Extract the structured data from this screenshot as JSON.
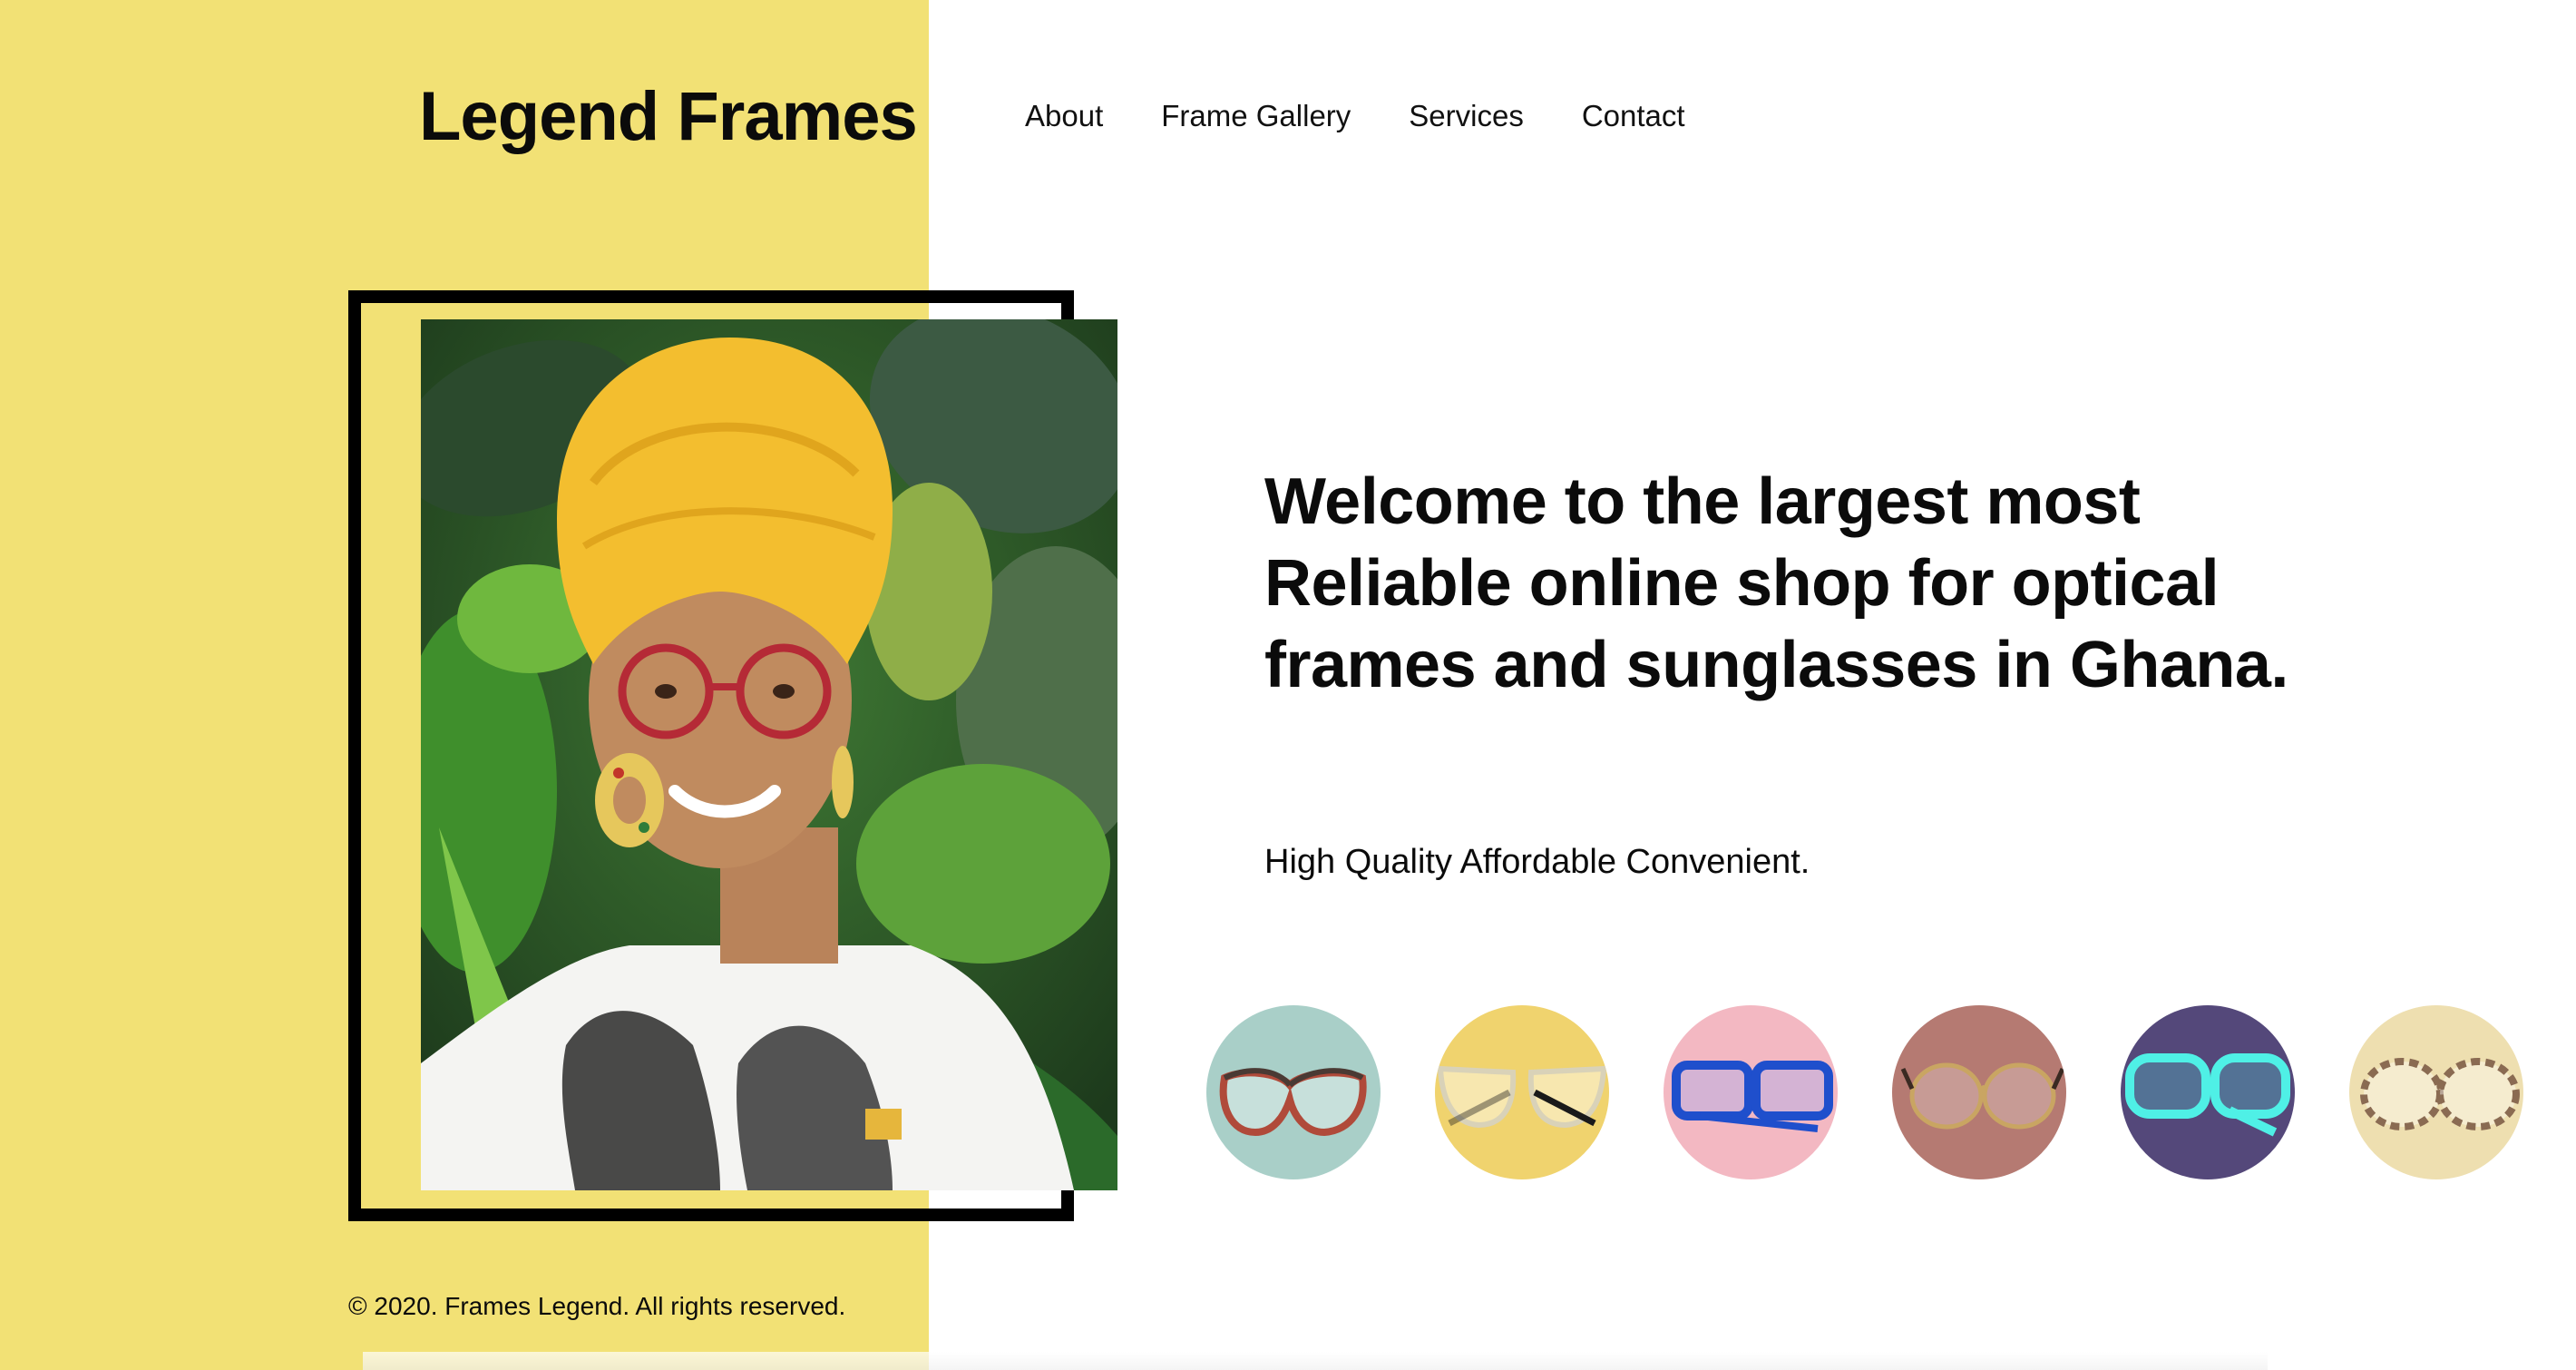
{
  "brand": {
    "name": "Legend Frames"
  },
  "nav": [
    {
      "label": "About"
    },
    {
      "label": "Frame Gallery"
    },
    {
      "label": "Services"
    },
    {
      "label": "Contact"
    }
  ],
  "hero": {
    "headline": "Welcome to the largest most Reliable online shop for optical frames and sunglasses in Ghana.",
    "tagline": "High Quality Affordable Convenient."
  },
  "frames": [
    {
      "icon": "tortoise-red-glasses-icon",
      "background": "#a9cfc8",
      "frame_color": "#b04a3a"
    },
    {
      "icon": "clear-black-glasses-icon",
      "background": "#f0d36e",
      "frame_color": "#d9d2b8"
    },
    {
      "icon": "blue-glasses-icon",
      "background": "#f3b8c2",
      "frame_color": "#1f4fcc"
    },
    {
      "icon": "gold-wire-glasses-icon",
      "background": "#b57a72",
      "frame_color": "#c9a562"
    },
    {
      "icon": "cyan-glasses-icon",
      "background": "#54487a",
      "frame_color": "#4ff0e6"
    },
    {
      "icon": "tortoise-glasses-icon",
      "background": "#eedfb0",
      "frame_color": "#8a6b52"
    }
  ],
  "footer": {
    "copyright": "© 2020. Frames Legend. All rights reserved."
  },
  "colors": {
    "accent_yellow": "#f2e175",
    "text": "#0b0b0b",
    "background": "#ffffff"
  }
}
